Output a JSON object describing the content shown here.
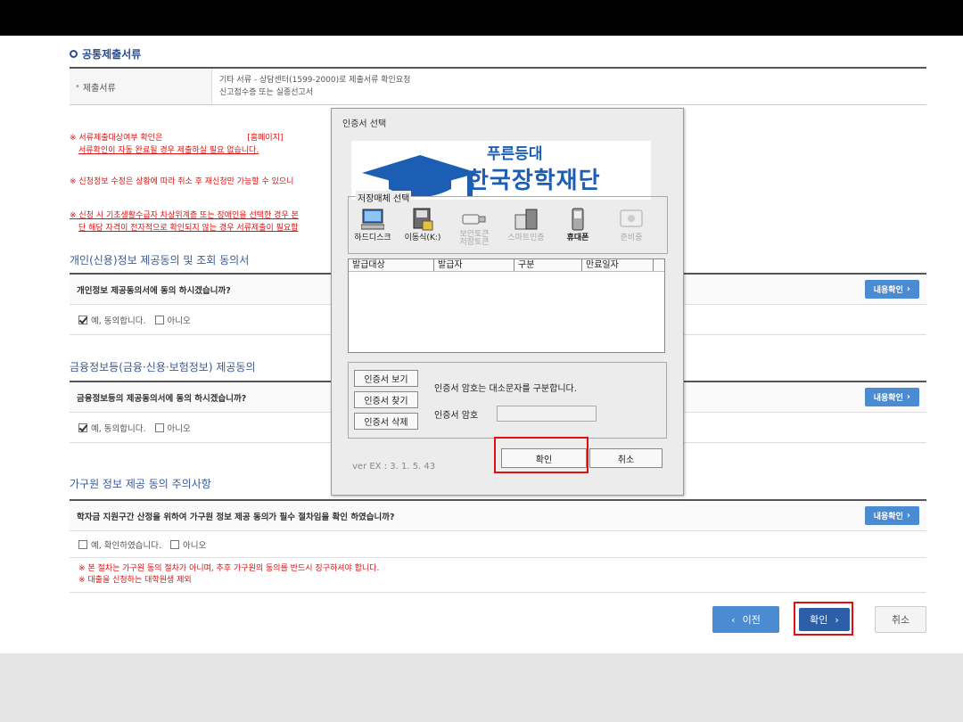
{
  "docs_section": {
    "title": "공통제출서류",
    "header": "제출서류",
    "line1": "기타 서류 - 상담센터(1599-2000)로 제출서류 확인요청",
    "line2": "신고접수증 또는 실종선고서"
  },
  "notes": {
    "n1a": "※ 서류제출대상여부 확인은",
    "n1b": "[홈페이지]",
    "n1c": "서류확인이 자동 완료될 경우 제출하실 필요 없습니다.",
    "n2": "※ 신청정보 수정은 상황에 따라 취소 후 재신청만 가능할 수 있으니",
    "n3a": "※ 신청 시 기초생활수급자 차상위계층 또는 장애인을 선택한 경우 본",
    "n3b": "단 해당 자격이 전자적으로 확인되지 않는 경우 서류제출이 필요합"
  },
  "personal": {
    "title": "개인(신용)정보 제공동의 및 조회 동의서",
    "question": "개인정보 제공동의서에 동의 하시겠습니까?",
    "detail_btn": "내용확인",
    "yes": "예, 동의합니다.",
    "no": "아니오"
  },
  "financial": {
    "title": "금융정보등(금융·신용·보험정보) 제공동의",
    "question": "금융정보등의 제공동의서에 동의 하시겠습니까?",
    "detail_btn": "내용확인",
    "yes": "예, 동의합니다.",
    "no": "아니오"
  },
  "family": {
    "title": "가구원 정보 제공 동의 주의사항",
    "question": "학자금 지원구간 산정을 위하여 가구원 정보 제공 동의가 필수 절차임을 확인 하였습니까?",
    "detail_btn": "내용확인",
    "yes": "예, 확인하였습니다.",
    "no": "아니오",
    "note1": "※ 본 절차는 가구원 동의 절차가 아니며, 추후 가구원의 동의를 반드시 징구하셔야 합니다.",
    "note2": "※ 대출을 신청하는 대학원생 제외"
  },
  "nav": {
    "prev": "이전",
    "confirm": "확인",
    "cancel": "취소"
  },
  "dialog": {
    "title": "인증서 선택",
    "logo_sub": "푸른등대",
    "logo_main": "한국장학재단",
    "media_legend": "저장매체 선택",
    "media": [
      "하드디스크",
      "이동식(K:)",
      "보안토큰",
      "스마트인증",
      "휴대폰",
      "준비중"
    ],
    "media_token_sub": "저장토큰",
    "columns": [
      "발급대상",
      "발급자",
      "구분",
      "만료일자"
    ],
    "view_btn": "인증서 보기",
    "find_btn": "인증서 찾기",
    "delete_btn": "인증서 삭제",
    "hint": "인증서 암호는 대소문자를 구분합니다.",
    "pw_label": "인증서 암호",
    "ok": "확인",
    "cancel": "취소",
    "version": "ver EX : 3. 1. 5. 43"
  },
  "colors": {
    "accent_blue": "#4a8bd1",
    "brand_blue": "#1c5eb3",
    "highlight_red": "#e01010"
  }
}
